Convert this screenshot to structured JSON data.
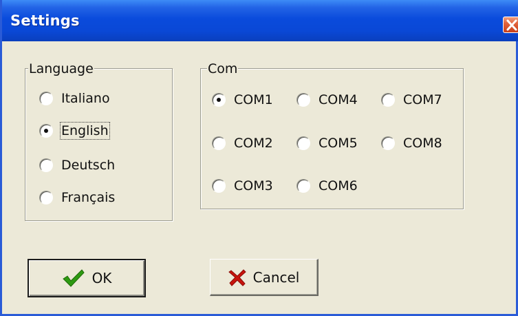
{
  "window": {
    "title": "Settings"
  },
  "icons": {
    "close": "close-icon",
    "ok": "checkmark-icon",
    "cancel": "x-icon"
  },
  "colors": {
    "titlebar": "#0a48d6",
    "face": "#ece9d8",
    "close": "#e2633c",
    "check_green": "#2e9a12",
    "cancel_red": "#c8140c"
  },
  "language": {
    "legend": "Language",
    "options": [
      {
        "label": "Italiano",
        "selected": false
      },
      {
        "label": "English",
        "selected": true
      },
      {
        "label": "Deutsch",
        "selected": false
      },
      {
        "label": "Français",
        "selected": false
      }
    ]
  },
  "com": {
    "legend": "Com",
    "options": [
      {
        "label": "COM1",
        "selected": true
      },
      {
        "label": "COM2",
        "selected": false
      },
      {
        "label": "COM3",
        "selected": false
      },
      {
        "label": "COM4",
        "selected": false
      },
      {
        "label": "COM5",
        "selected": false
      },
      {
        "label": "COM6",
        "selected": false
      },
      {
        "label": "COM7",
        "selected": false
      },
      {
        "label": "COM8",
        "selected": false
      }
    ]
  },
  "buttons": {
    "ok_label": "OK",
    "cancel_label": "Cancel"
  }
}
